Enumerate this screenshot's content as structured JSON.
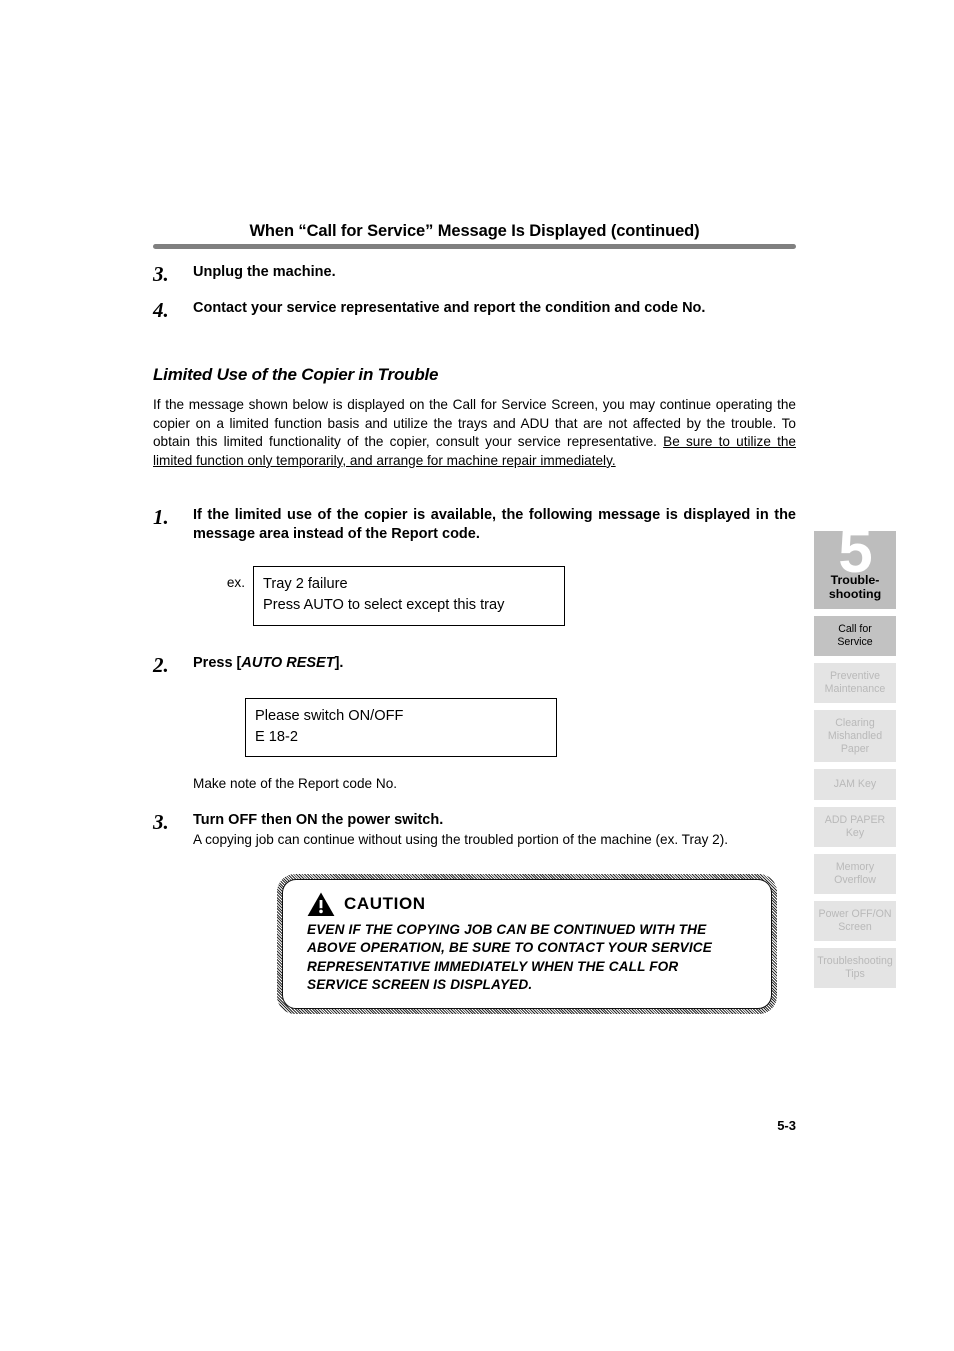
{
  "header": {
    "title": "When “Call for Service” Message Is Displayed (continued)"
  },
  "top_steps": [
    {
      "num": "3.",
      "title": "Unplug the machine."
    },
    {
      "num": "4.",
      "title": "Contact your service representative and report the condition and code No."
    }
  ],
  "section": {
    "heading": "Limited Use of the Copier in Trouble",
    "paragraph_plain": "If the message shown below is displayed on the Call for Service Screen, you may continue operating the copier on a limited function basis and utilize the trays and ADU that are not affected by the trouble. To obtain this limited functionality of the copier, consult your service representative. ",
    "paragraph_underlined": "Be sure to utilize the limited function only temporarily, and arrange for machine repair immediately."
  },
  "procedure": {
    "step1": {
      "num": "1.",
      "title": "If the limited use of the copier is available, the following message is displayed in the message area instead of the Report code.",
      "example_label": "ex.",
      "message_line1": "Tray 2 failure",
      "message_line2": "Press AUTO to select except this tray"
    },
    "step2": {
      "num": "2.",
      "title_prefix": "Press [",
      "title_key": "AUTO RESET",
      "title_suffix": "].",
      "message_line1": "Please switch ON/OFF",
      "message_line2": "E 18-2",
      "note": "Make note of the Report code No."
    },
    "step3": {
      "num": "3.",
      "title": "Turn OFF then ON the power switch.",
      "body": "A copying job can continue without using the troubled portion of the machine (ex. Tray 2)."
    }
  },
  "caution": {
    "icon": "warning-triangle-icon",
    "label": "CAUTION",
    "lines": [
      "EVEN IF THE COPYING JOB CAN BE CONTINUED WITH THE",
      "ABOVE OPERATION, BE SURE TO CONTACT YOUR SERVICE",
      "REPRESENTATIVE IMMEDIATELY WHEN THE CALL FOR",
      "SERVICE SCREEN IS DISPLAYED."
    ]
  },
  "sidebar": {
    "chapter": {
      "number": "5",
      "label_line1": "Trouble-",
      "label_line2": "shooting"
    },
    "tabs": [
      {
        "line1": "Call for",
        "line2": "Service",
        "line3": "",
        "active": true
      },
      {
        "line1": "Preventive",
        "line2": "Maintenance",
        "line3": "",
        "active": false
      },
      {
        "line1": "Clearing",
        "line2": "Mishandled",
        "line3": "Paper",
        "active": false
      },
      {
        "line1": "JAM Key",
        "line2": "",
        "line3": "",
        "active": false
      },
      {
        "line1": "ADD PAPER",
        "line2": "Key",
        "line3": "",
        "active": false
      },
      {
        "line1": "Memory",
        "line2": "Overflow",
        "line3": "",
        "active": false
      },
      {
        "line1": "Power OFF/ON",
        "line2": "Screen",
        "line3": "",
        "active": false
      },
      {
        "line1": "Troubleshooting",
        "line2": "Tips",
        "line3": "",
        "active": false
      }
    ]
  },
  "folio": {
    "page_number": "5-3"
  },
  "colors": {
    "rule": "#808080",
    "chapter_tab_bg": "#bdbdbd",
    "active_tab_bg": "#c2c2c2",
    "inactive_tab_bg": "#e4e4e4",
    "inactive_tab_text": "#b9b9b9"
  }
}
